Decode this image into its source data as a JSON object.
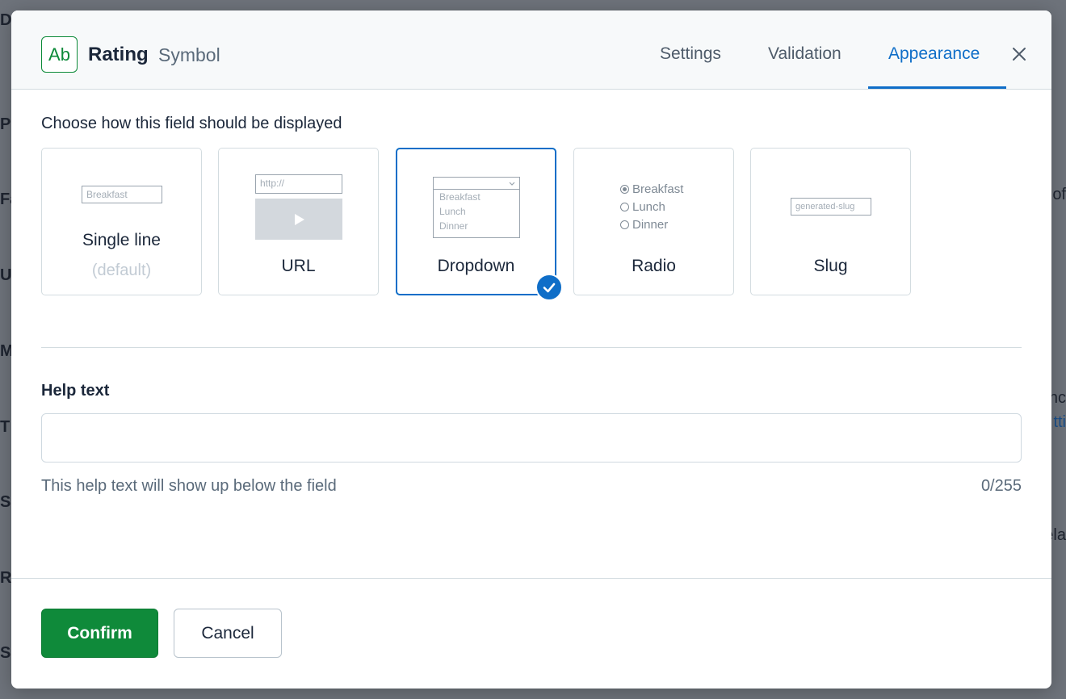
{
  "backdrop": {
    "left_letters": [
      "D",
      "P",
      "Fa",
      "U",
      "M",
      "T",
      "Sa",
      "R",
      "S"
    ],
    "right_fragments": [
      "of",
      "nc",
      "tti",
      "ela"
    ]
  },
  "header": {
    "field_icon_text": "Ab",
    "field_name": "Rating",
    "field_type": "Symbol",
    "tabs": [
      {
        "label": "Settings",
        "active": false
      },
      {
        "label": "Validation",
        "active": false
      },
      {
        "label": "Appearance",
        "active": true
      }
    ],
    "close_icon": "close-icon"
  },
  "appearance": {
    "prompt": "Choose how this field should be displayed",
    "selected": "Dropdown",
    "options": [
      {
        "label": "Single line",
        "sublabel": "(default)",
        "preview_text": "Breakfast"
      },
      {
        "label": "URL",
        "preview_text": "http://"
      },
      {
        "label": "Dropdown",
        "preview_items": [
          "Breakfast",
          "Lunch",
          "Dinner"
        ]
      },
      {
        "label": "Radio",
        "preview_items": [
          "Breakfast",
          "Lunch",
          "Dinner"
        ]
      },
      {
        "label": "Slug",
        "preview_text": "generated-slug"
      }
    ]
  },
  "help": {
    "label": "Help text",
    "value": "",
    "hint": "This help text will show up below the field",
    "counter": "0/255"
  },
  "footer": {
    "confirm_label": "Confirm",
    "cancel_label": "Cancel"
  },
  "colors": {
    "accent": "#0f6ec8",
    "confirm": "#0f8a3a",
    "field_icon": "#0d8a39"
  }
}
